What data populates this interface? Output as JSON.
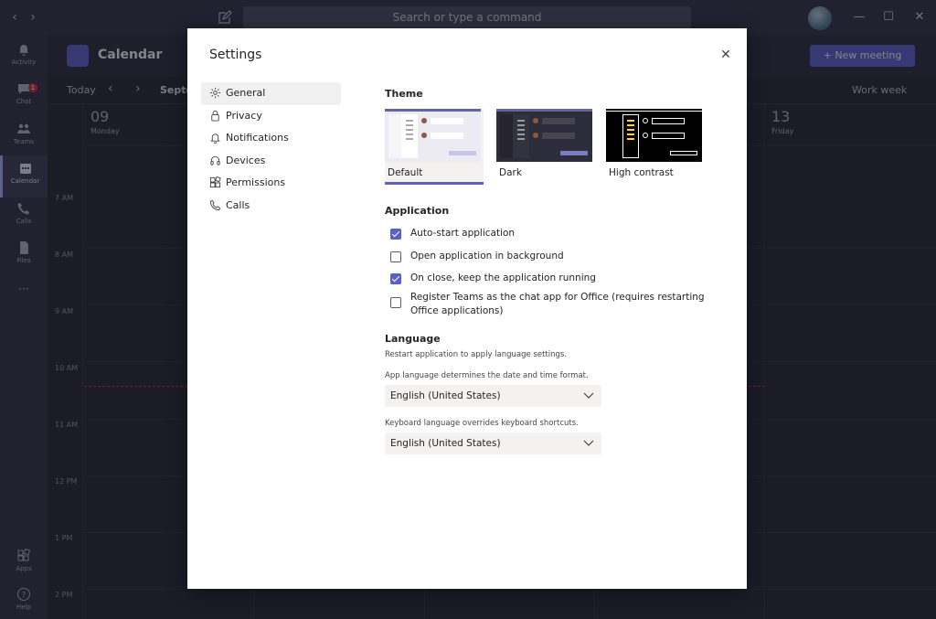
{
  "titlebar": {
    "search_placeholder": "Search or type a command",
    "back_glyph": "‹",
    "forward_glyph": "›",
    "minimize_glyph": "—",
    "maximize_glyph": "☐",
    "close_glyph": "✕"
  },
  "rail": {
    "items": [
      {
        "label": "Activity",
        "icon": "bell-icon"
      },
      {
        "label": "Chat",
        "icon": "chat-icon",
        "badge": "1"
      },
      {
        "label": "Teams",
        "icon": "teams-icon"
      },
      {
        "label": "Calendar",
        "icon": "calendar-icon",
        "active": true
      },
      {
        "label": "Calls",
        "icon": "phone-icon"
      },
      {
        "label": "Files",
        "icon": "file-icon"
      }
    ],
    "more": "···",
    "apps_label": "Apps",
    "help_label": "Help"
  },
  "calendar": {
    "title": "Calendar",
    "new_meeting": "New meeting",
    "new_meeting_prefix": "+",
    "today": "Today",
    "month": "Septe",
    "view": "Work week",
    "days": [
      {
        "num": "09",
        "name": "Monday"
      },
      {
        "num": "13",
        "name": "Friday"
      }
    ],
    "times": [
      "7 AM",
      "8 AM",
      "9 AM",
      "10 AM",
      "11 AM",
      "12 PM",
      "1 PM",
      "2 PM"
    ]
  },
  "settings": {
    "title": "Settings",
    "close_glyph": "✕",
    "nav": [
      {
        "label": "General",
        "icon": "gear-icon",
        "active": true
      },
      {
        "label": "Privacy",
        "icon": "lock-icon"
      },
      {
        "label": "Notifications",
        "icon": "bell-icon"
      },
      {
        "label": "Devices",
        "icon": "headset-icon"
      },
      {
        "label": "Permissions",
        "icon": "permissions-icon"
      },
      {
        "label": "Calls",
        "icon": "phone-icon"
      }
    ],
    "theme": {
      "title": "Theme",
      "options": [
        {
          "label": "Default",
          "selected": true
        },
        {
          "label": "Dark"
        },
        {
          "label": "High contrast"
        }
      ]
    },
    "application": {
      "title": "Application",
      "options": [
        {
          "label": "Auto-start application",
          "checked": true
        },
        {
          "label": "Open application in background",
          "checked": false
        },
        {
          "label": "On close, keep the application running",
          "checked": true
        },
        {
          "label": "Register Teams as the chat app for Office (requires restarting Office applications)",
          "checked": false
        }
      ]
    },
    "language": {
      "title": "Language",
      "restart_hint": "Restart application to apply language settings.",
      "app_hint": "App language determines the date and time format.",
      "app_value": "English (United States)",
      "keyboard_hint": "Keyboard language overrides keyboard shortcuts.",
      "keyboard_value": "English (United States)"
    }
  },
  "colors": {
    "accent": "#5b5fc7",
    "rail_bg": "#33344a",
    "calendar_bg": "#292a37",
    "badge": "#c4314b"
  }
}
